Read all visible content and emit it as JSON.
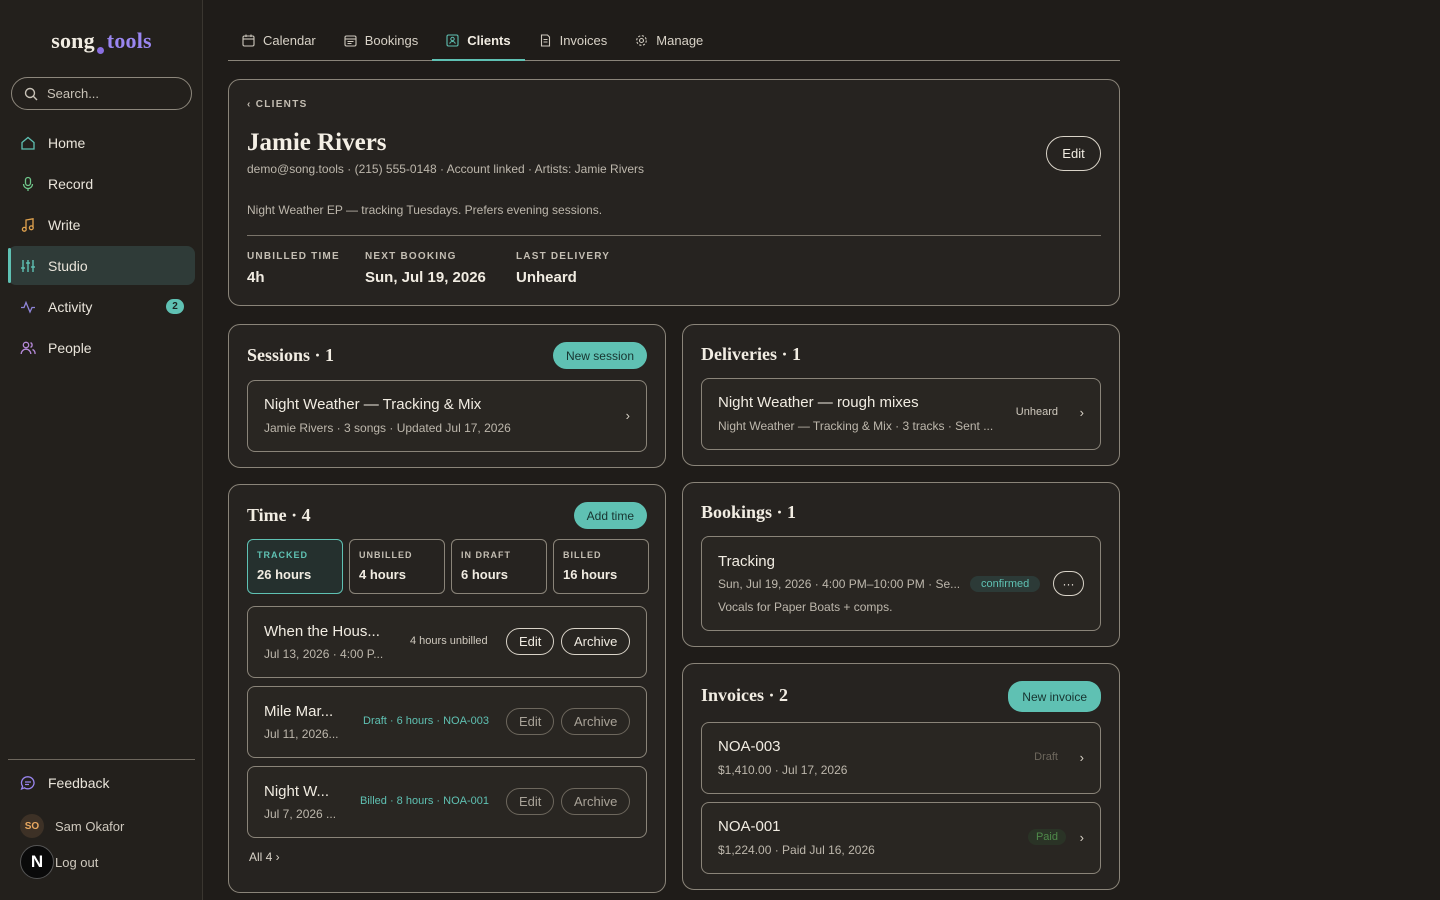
{
  "brand": {
    "part1": "song",
    "part2": "tools"
  },
  "search": {
    "placeholder": "Search..."
  },
  "sidebar": {
    "items": [
      {
        "label": "Home",
        "icon": "home-icon"
      },
      {
        "label": "Record",
        "icon": "mic-icon"
      },
      {
        "label": "Write",
        "icon": "music-note-icon"
      },
      {
        "label": "Studio",
        "icon": "sliders-icon",
        "active": true
      },
      {
        "label": "Activity",
        "icon": "activity-icon",
        "badge": "2"
      },
      {
        "label": "People",
        "icon": "people-icon"
      }
    ],
    "feedback": "Feedback",
    "user": {
      "initials": "SO",
      "name": "Sam Okafor"
    },
    "logout": "Log out",
    "n_badge": "N"
  },
  "tabs": [
    {
      "label": "Calendar",
      "icon": "calendar-icon"
    },
    {
      "label": "Bookings",
      "icon": "bookings-icon"
    },
    {
      "label": "Clients",
      "icon": "clients-icon",
      "active": true
    },
    {
      "label": "Invoices",
      "icon": "invoice-icon"
    },
    {
      "label": "Manage",
      "icon": "gear-icon"
    }
  ],
  "client": {
    "breadcrumb": "‹ CLIENTS",
    "name": "Jamie Rivers",
    "meta": "demo@song.tools · (215) 555-0148 · Account linked · Artists: Jamie Rivers",
    "note": "Night Weather EP — tracking Tuesdays. Prefers evening sessions.",
    "edit_label": "Edit",
    "stats": [
      {
        "label": "UNBILLED TIME",
        "value": "4h"
      },
      {
        "label": "NEXT BOOKING",
        "value": "Sun, Jul 19, 2026"
      },
      {
        "label": "LAST DELIVERY",
        "value": "Unheard"
      }
    ]
  },
  "sessions": {
    "title": "Sessions · 1",
    "button": "New session",
    "items": [
      {
        "title": "Night Weather — Tracking & Mix",
        "sub": "Jamie Rivers · 3 songs · Updated Jul 17, 2026"
      }
    ]
  },
  "time": {
    "title": "Time · 4",
    "button": "Add time",
    "tiles": [
      {
        "label": "TRACKED",
        "value": "26 hours"
      },
      {
        "label": "UNBILLED",
        "value": "4 hours"
      },
      {
        "label": "IN DRAFT",
        "value": "6 hours"
      },
      {
        "label": "BILLED",
        "value": "16 hours"
      }
    ],
    "entries": [
      {
        "title": "When the Hous...",
        "sub": "Jul 13, 2026 · 4:00 P...",
        "status": "4 hours unbilled",
        "edit": "Edit",
        "archive": "Archive"
      },
      {
        "title": "Mile Mar...",
        "sub": "Jul 11, 2026...",
        "status": "Draft · 6 hours · NOA-003",
        "edit": "Edit",
        "archive": "Archive"
      },
      {
        "title": "Night W...",
        "sub": "Jul 7, 2026 ...",
        "status": "Billed · 8 hours · NOA-001",
        "edit": "Edit",
        "archive": "Archive"
      }
    ],
    "all_link": "All 4 ›"
  },
  "deliveries": {
    "title": "Deliveries · 1",
    "items": [
      {
        "title": "Night Weather — rough mixes",
        "sub": "Night Weather — Tracking & Mix · 3 tracks · Sent ...",
        "status": "Unheard"
      }
    ]
  },
  "bookings": {
    "title": "Bookings · 1",
    "items": [
      {
        "title": "Tracking",
        "sub": "Sun, Jul 19, 2026 · 4:00 PM–10:00 PM · Se...",
        "note": "Vocals for Paper Boats + comps.",
        "status": "confirmed",
        "more": "···"
      }
    ]
  },
  "invoices": {
    "title": "Invoices · 2",
    "button": "New invoice",
    "items": [
      {
        "title": "NOA-003",
        "sub": "$1,410.00 · Jul 17, 2026",
        "status": "Draft"
      },
      {
        "title": "NOA-001",
        "sub": "$1,224.00 · Paid Jul 16, 2026",
        "status": "Paid"
      }
    ]
  },
  "colors": {
    "accent": "#5fc1b3",
    "background": "#1f1c19",
    "brand_purple": "#9a86f0",
    "paid": "#4f8a4a"
  }
}
